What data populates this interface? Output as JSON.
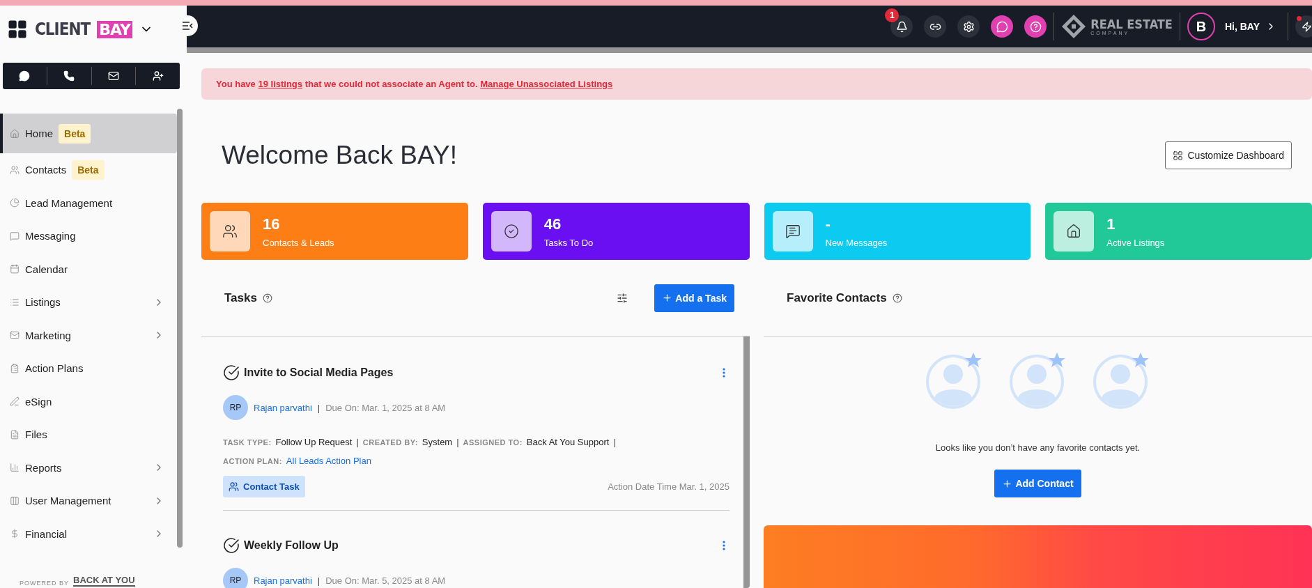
{
  "brand": {
    "name": "CLIENT",
    "highlight": "BAY"
  },
  "sidebar": {
    "items": [
      {
        "label": "Home",
        "badge": "Beta",
        "selected": true,
        "submenu": false
      },
      {
        "label": "Contacts",
        "badge": "Beta",
        "selected": false,
        "submenu": false
      },
      {
        "label": "Lead Management",
        "selected": false,
        "submenu": false
      },
      {
        "label": "Messaging",
        "selected": false,
        "submenu": false
      },
      {
        "label": "Calendar",
        "selected": false,
        "submenu": false
      },
      {
        "label": "Listings",
        "selected": false,
        "submenu": true
      },
      {
        "label": "Marketing",
        "selected": false,
        "submenu": true
      },
      {
        "label": "Action Plans",
        "selected": false,
        "submenu": false
      },
      {
        "label": "eSign",
        "selected": false,
        "submenu": false
      },
      {
        "label": "Files",
        "selected": false,
        "submenu": false
      },
      {
        "label": "Reports",
        "selected": false,
        "submenu": true
      },
      {
        "label": "User Management",
        "selected": false,
        "submenu": true
      },
      {
        "label": "Financial",
        "selected": false,
        "submenu": true
      }
    ],
    "footer": {
      "prefix": "POWERED BY",
      "brand": "BACK AT YOU"
    }
  },
  "topbar": {
    "notification_count": "1",
    "company": {
      "name": "REAL ESTATE",
      "tagline": "COMPANY"
    },
    "avatar": "B",
    "greeting": "Hi, BAY",
    "has_alert": true
  },
  "banner": {
    "before": "You have ",
    "link": "19 listings",
    "after": " that we could not associate an Agent to. ",
    "action": "Manage Unassociated Listings"
  },
  "welcome": "Welcome Back BAY!",
  "customize_button": "Customize Dashboard",
  "stats": [
    {
      "kind": "contacts",
      "value": "16",
      "label": "Contacts & Leads",
      "color": "#fd7e14"
    },
    {
      "kind": "tasks",
      "value": "46",
      "label": "Tasks To Do",
      "color": "#6a0ff2"
    },
    {
      "kind": "messages",
      "value": "-",
      "label": "New Messages",
      "color": "#0dcaf0"
    },
    {
      "kind": "listings",
      "value": "1",
      "label": "Active Listings",
      "color": "#20c997"
    }
  ],
  "tasks": {
    "title": "Tasks",
    "add_button": "Add a Task",
    "separator": "|",
    "items": [
      {
        "title": "Invite to Social Media Pages",
        "initials": "RP",
        "assignee": "Rajan parvathi",
        "due": "Due On: Mar. 1, 2025 at 8 AM",
        "fields": [
          {
            "label": "TASK TYPE:",
            "value": "Follow Up Request",
            "link": false
          },
          {
            "label": "CREATED BY:",
            "value": "System",
            "link": false
          },
          {
            "label": "ASSIGNED TO:",
            "value": "Back At You Support",
            "link": false
          },
          {
            "label": "ACTION PLAN:",
            "value": "All Leads Action Plan",
            "link": true
          }
        ],
        "tag": "Contact Task",
        "action_date": "Action Date Time Mar. 1, 2025"
      },
      {
        "title": "Weekly Follow Up",
        "initials": "RP",
        "assignee": "Rajan parvathi",
        "due": "Due On: Mar. 5, 2025 at 8 AM"
      }
    ]
  },
  "favorites": {
    "title": "Favorite Contacts",
    "empty_text": "Looks like you don’t have any favorite contacts yet.",
    "add_button": "Add Contact"
  }
}
